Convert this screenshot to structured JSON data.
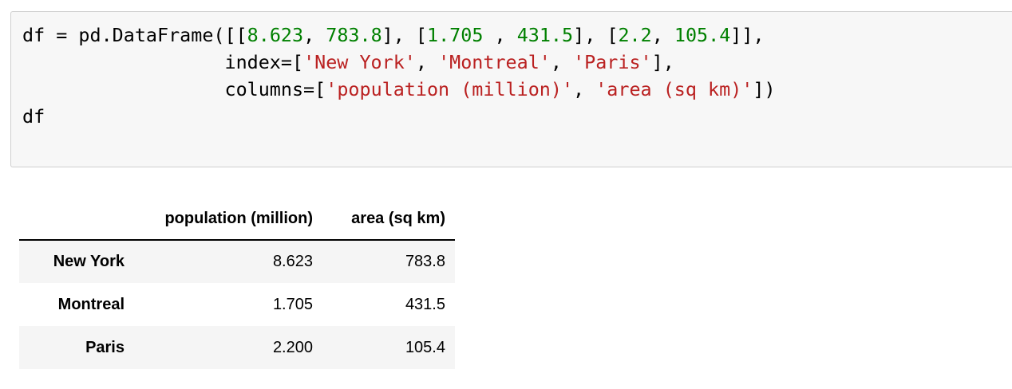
{
  "code_cell": {
    "lines": [
      [
        {
          "t": "df = pd.DataFrame([[",
          "c": "o"
        },
        {
          "t": "8.623",
          "c": "n"
        },
        {
          "t": ", ",
          "c": "o"
        },
        {
          "t": "783.8",
          "c": "n"
        },
        {
          "t": "], [",
          "c": "o"
        },
        {
          "t": "1.705",
          "c": "n"
        },
        {
          "t": " , ",
          "c": "o"
        },
        {
          "t": "431.5",
          "c": "n"
        },
        {
          "t": "], [",
          "c": "o"
        },
        {
          "t": "2.2",
          "c": "n"
        },
        {
          "t": ", ",
          "c": "o"
        },
        {
          "t": "105.4",
          "c": "n"
        },
        {
          "t": "]],",
          "c": "o"
        }
      ],
      [
        {
          "t": "                  index=[",
          "c": "o"
        },
        {
          "t": "'New York'",
          "c": "s"
        },
        {
          "t": ", ",
          "c": "o"
        },
        {
          "t": "'Montreal'",
          "c": "s"
        },
        {
          "t": ", ",
          "c": "o"
        },
        {
          "t": "'Paris'",
          "c": "s"
        },
        {
          "t": "],",
          "c": "o"
        }
      ],
      [
        {
          "t": "                  columns=[",
          "c": "o"
        },
        {
          "t": "'population (million)'",
          "c": "s"
        },
        {
          "t": ", ",
          "c": "o"
        },
        {
          "t": "'area (sq km)'",
          "c": "s"
        },
        {
          "t": "])",
          "c": "o"
        }
      ],
      [
        {
          "t": "df",
          "c": "o"
        }
      ]
    ]
  },
  "output_table": {
    "corner": "",
    "columns": [
      "population (million)",
      "area (sq km)"
    ],
    "rows": [
      {
        "index": "New York",
        "values": [
          "8.623",
          "783.8"
        ]
      },
      {
        "index": "Montreal",
        "values": [
          "1.705",
          "431.5"
        ]
      },
      {
        "index": "Paris",
        "values": [
          "2.200",
          "105.4"
        ]
      }
    ]
  },
  "colors": {
    "cell_background": "#f7f7f7",
    "cell_border": "#cfcfcf",
    "number_literal": "#008000",
    "string_literal": "#ba2121",
    "row_stripe": "#f5f5f5"
  }
}
